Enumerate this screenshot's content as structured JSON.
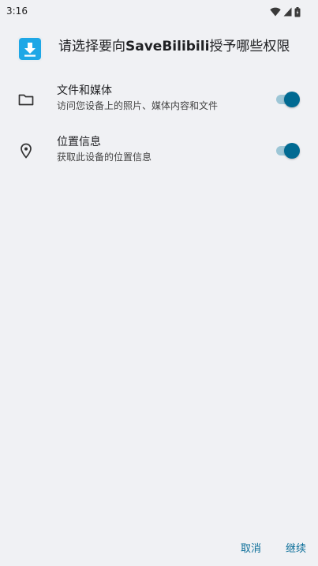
{
  "status_bar": {
    "time": "3:16",
    "icons": [
      "wifi-icon",
      "signal-icon",
      "battery-icon"
    ]
  },
  "header": {
    "title_prefix": "请选择要向",
    "app_name": "SaveBilibili",
    "title_suffix": "授予哪些权限",
    "app_icon": "download-icon"
  },
  "permissions": [
    {
      "icon": "folder-icon",
      "title": "文件和媒体",
      "description": "访问您设备上的照片、媒体内容和文件",
      "enabled": true
    },
    {
      "icon": "location-pin-icon",
      "title": "位置信息",
      "description": "获取此设备的位置信息",
      "enabled": true
    }
  ],
  "footer": {
    "cancel_label": "取消",
    "continue_label": "继续"
  },
  "colors": {
    "background": "#f0f1f4",
    "accent": "#016a92",
    "toggle_track": "#9dc6d6",
    "button_text": "#0b6e99",
    "app_icon_bg": "#1ea7e6"
  }
}
